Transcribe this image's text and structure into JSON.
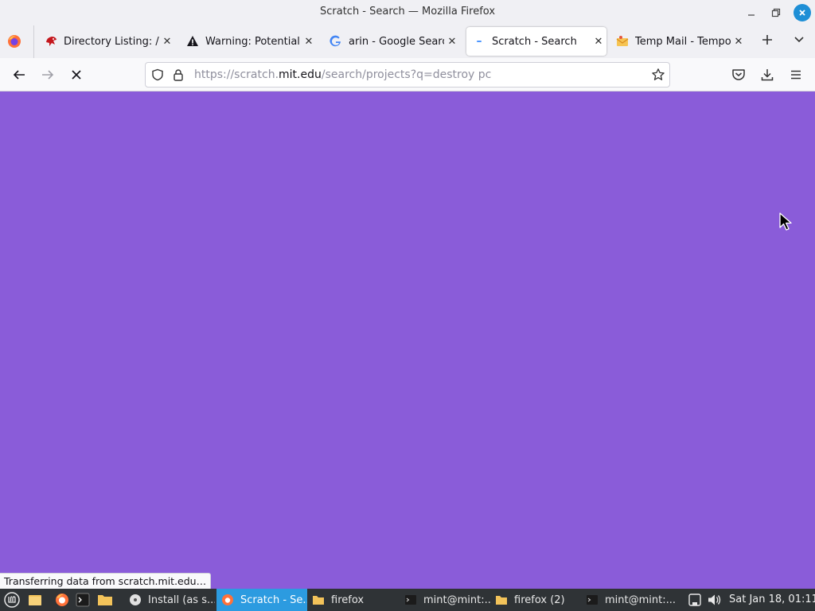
{
  "window": {
    "title": "Scratch - Search — Mozilla Firefox"
  },
  "tabs": [
    {
      "label": "Directory Listing: /p",
      "icon": "red-bird-icon",
      "active": false
    },
    {
      "label": "Warning: Potential S",
      "icon": "warning-icon",
      "active": false
    },
    {
      "label": "arin - Google Search",
      "icon": "google-icon",
      "active": false
    },
    {
      "label": "Scratch - Search",
      "icon": "scratch-icon",
      "active": true
    },
    {
      "label": "Temp Mail - Tempor",
      "icon": "mail-icon",
      "active": false
    }
  ],
  "navbar": {
    "url_prefix": "https://scratch.",
    "url_host": "mit.edu",
    "url_path": "/search/projects?q=destroy pc"
  },
  "content": {
    "background": "#8a5cd9"
  },
  "status": {
    "text": "Transferring data from scratch.mit.edu…"
  },
  "taskbar": {
    "items": [
      {
        "label": "Install (as s...",
        "icon": "disc-icon",
        "active": false
      },
      {
        "label": "Scratch - Se...",
        "icon": "firefox-icon",
        "active": true
      },
      {
        "label": "firefox",
        "icon": "folder-icon",
        "active": false
      },
      {
        "label": "mint@mint:...",
        "icon": "terminal-icon",
        "active": false
      },
      {
        "label": "firefox (2)",
        "icon": "folder-icon",
        "active": false
      },
      {
        "label": "mint@mint:...",
        "icon": "terminal-icon",
        "active": false
      }
    ],
    "clock": "Sat Jan 18, 01:11"
  },
  "colors": {
    "accent": "#2c9be0",
    "page_background": "#8a5cd9",
    "taskbar": "#2f3336"
  }
}
